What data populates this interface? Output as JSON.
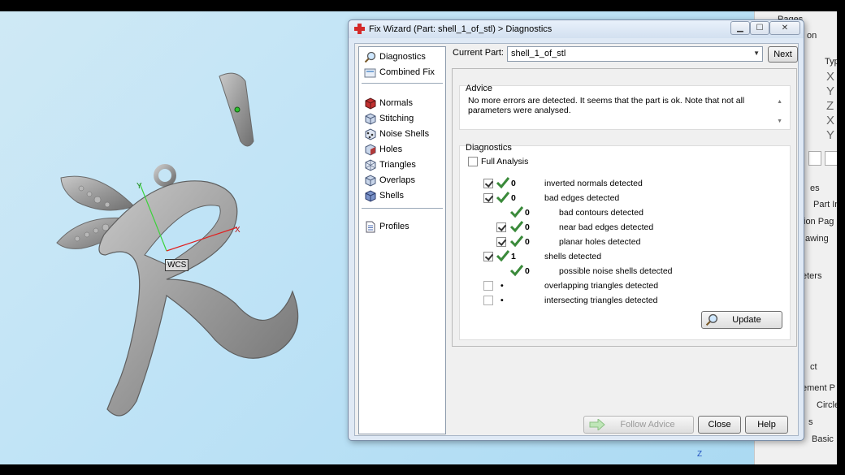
{
  "viewport": {
    "axis_label": "WCS",
    "x_axis": "X",
    "y_axis": "Y",
    "z_axis": "Z"
  },
  "right_panel": {
    "items": [
      "Pages",
      "on",
      "Typ",
      "X",
      "Y",
      "Z",
      "X",
      "Y",
      "es",
      "Part In",
      "ion Pag",
      "awing",
      "eters",
      "ct",
      "ement P",
      "Circle",
      "s",
      "Basic"
    ]
  },
  "dialog": {
    "title": "Fix Wizard (Part: shell_1_of_stl) > Diagnostics",
    "nav": {
      "group1": [
        "Diagnostics",
        "Combined Fix"
      ],
      "group2": [
        "Normals",
        "Stitching",
        "Noise Shells",
        "Holes",
        "Triangles",
        "Overlaps",
        "Shells"
      ],
      "group3": [
        "Profiles"
      ]
    },
    "current_part_label": "Current Part:",
    "current_part_value": "shell_1_of_stl",
    "next_label": "Next",
    "advice_label": "Advice",
    "advice_text": "No more errors are detected. It seems that the part is ok. Note that not all parameters were analysed.",
    "diagnostics_label": "Diagnostics",
    "full_analysis_label": "Full Analysis",
    "rows": [
      {
        "count": "0",
        "label": "inverted normals detected"
      },
      {
        "count": "0",
        "label": "bad edges detected"
      },
      {
        "count": "0",
        "label": "bad contours detected"
      },
      {
        "count": "0",
        "label": "near bad edges detected"
      },
      {
        "count": "0",
        "label": "planar holes detected"
      },
      {
        "count": "1",
        "label": "shells detected"
      },
      {
        "count": "0",
        "label": "possible noise shells detected"
      },
      {
        "count": "•",
        "label": "overlapping triangles detected"
      },
      {
        "count": "•",
        "label": "intersecting triangles detected"
      }
    ],
    "update_label": "Update",
    "follow_advice_label": "Follow Advice",
    "close_label": "Close",
    "help_label": "Help"
  },
  "colors": {
    "accent": "#3a8a3a",
    "dialog_frame": "#dfe9f5",
    "viewport": "#bfe3f6"
  }
}
